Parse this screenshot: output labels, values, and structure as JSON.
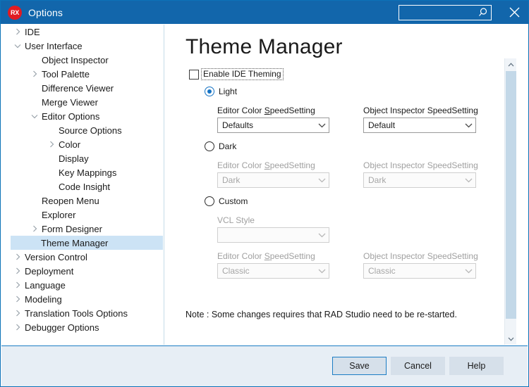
{
  "window": {
    "title": "Options",
    "app_icon": "rx-logo-icon",
    "close_label": "✕"
  },
  "search": {
    "value": "",
    "placeholder": "",
    "icon": "search-icon"
  },
  "sidebar": {
    "items": [
      {
        "label": "IDE",
        "depth": 0,
        "chevron": "right",
        "selected": false
      },
      {
        "label": "User Interface",
        "depth": 0,
        "chevron": "down",
        "selected": false
      },
      {
        "label": "Object Inspector",
        "depth": 1,
        "chevron": "none",
        "selected": false
      },
      {
        "label": "Tool Palette",
        "depth": 1,
        "chevron": "right",
        "selected": false
      },
      {
        "label": "Difference Viewer",
        "depth": 1,
        "chevron": "none",
        "selected": false
      },
      {
        "label": "Merge Viewer",
        "depth": 1,
        "chevron": "none",
        "selected": false
      },
      {
        "label": "Editor Options",
        "depth": 1,
        "chevron": "down",
        "selected": false
      },
      {
        "label": "Source Options",
        "depth": 2,
        "chevron": "none",
        "selected": false
      },
      {
        "label": "Color",
        "depth": 2,
        "chevron": "right",
        "selected": false
      },
      {
        "label": "Display",
        "depth": 2,
        "chevron": "none",
        "selected": false
      },
      {
        "label": "Key Mappings",
        "depth": 2,
        "chevron": "none",
        "selected": false
      },
      {
        "label": "Code Insight",
        "depth": 2,
        "chevron": "none",
        "selected": false
      },
      {
        "label": "Reopen Menu",
        "depth": 1,
        "chevron": "none",
        "selected": false
      },
      {
        "label": "Explorer",
        "depth": 1,
        "chevron": "none",
        "selected": false
      },
      {
        "label": "Form Designer",
        "depth": 1,
        "chevron": "right",
        "selected": false
      },
      {
        "label": "Theme Manager",
        "depth": 1,
        "chevron": "none",
        "selected": true
      },
      {
        "label": "Version Control",
        "depth": 0,
        "chevron": "right",
        "selected": false
      },
      {
        "label": "Deployment",
        "depth": 0,
        "chevron": "right",
        "selected": false
      },
      {
        "label": "Language",
        "depth": 0,
        "chevron": "right",
        "selected": false
      },
      {
        "label": "Modeling",
        "depth": 0,
        "chevron": "right",
        "selected": false
      },
      {
        "label": "Translation Tools Options",
        "depth": 0,
        "chevron": "right",
        "selected": false
      },
      {
        "label": "Debugger Options",
        "depth": 0,
        "chevron": "right",
        "selected": false
      }
    ]
  },
  "main": {
    "page_title": "Theme Manager",
    "enable_theming": {
      "label": "Enable IDE Theming",
      "checked": false,
      "focused": true
    },
    "light": {
      "radio_label": "Light",
      "selected": true,
      "enabled": true,
      "editor_label_pre": "Editor Color ",
      "editor_label_accel": "S",
      "editor_label_post": "peedSetting",
      "editor_value": "Defaults",
      "inspector_label": "Object Inspector SpeedSetting",
      "inspector_value": "Default"
    },
    "dark": {
      "radio_label": "Dark",
      "selected": false,
      "enabled": false,
      "editor_label_pre": "Editor Color ",
      "editor_label_accel": "S",
      "editor_label_post": "peedSetting",
      "editor_value": "Dark",
      "inspector_label": "Object Inspector SpeedSetting",
      "inspector_value": "Dark"
    },
    "custom": {
      "radio_label": "Custom",
      "selected": false,
      "enabled": false,
      "vcl_label": "VCL Style",
      "vcl_value": "",
      "editor_label_pre": "Editor Color ",
      "editor_label_accel": "S",
      "editor_label_post": "peedSetting",
      "editor_value": "Classic",
      "inspector_label": "Object Inspector SpeedSetting",
      "inspector_value": "Classic"
    },
    "note": "Note : Some changes requires that RAD Studio need to be re-started."
  },
  "footer": {
    "save_label": "Save",
    "cancel_label": "Cancel",
    "help_label": "Help"
  },
  "colors": {
    "titlebar": "#1266ab",
    "accent": "#1673c4",
    "selection": "#cce3f5",
    "footer_bg": "#e7eef5",
    "scroll_thumb": "#c3d8e8"
  }
}
